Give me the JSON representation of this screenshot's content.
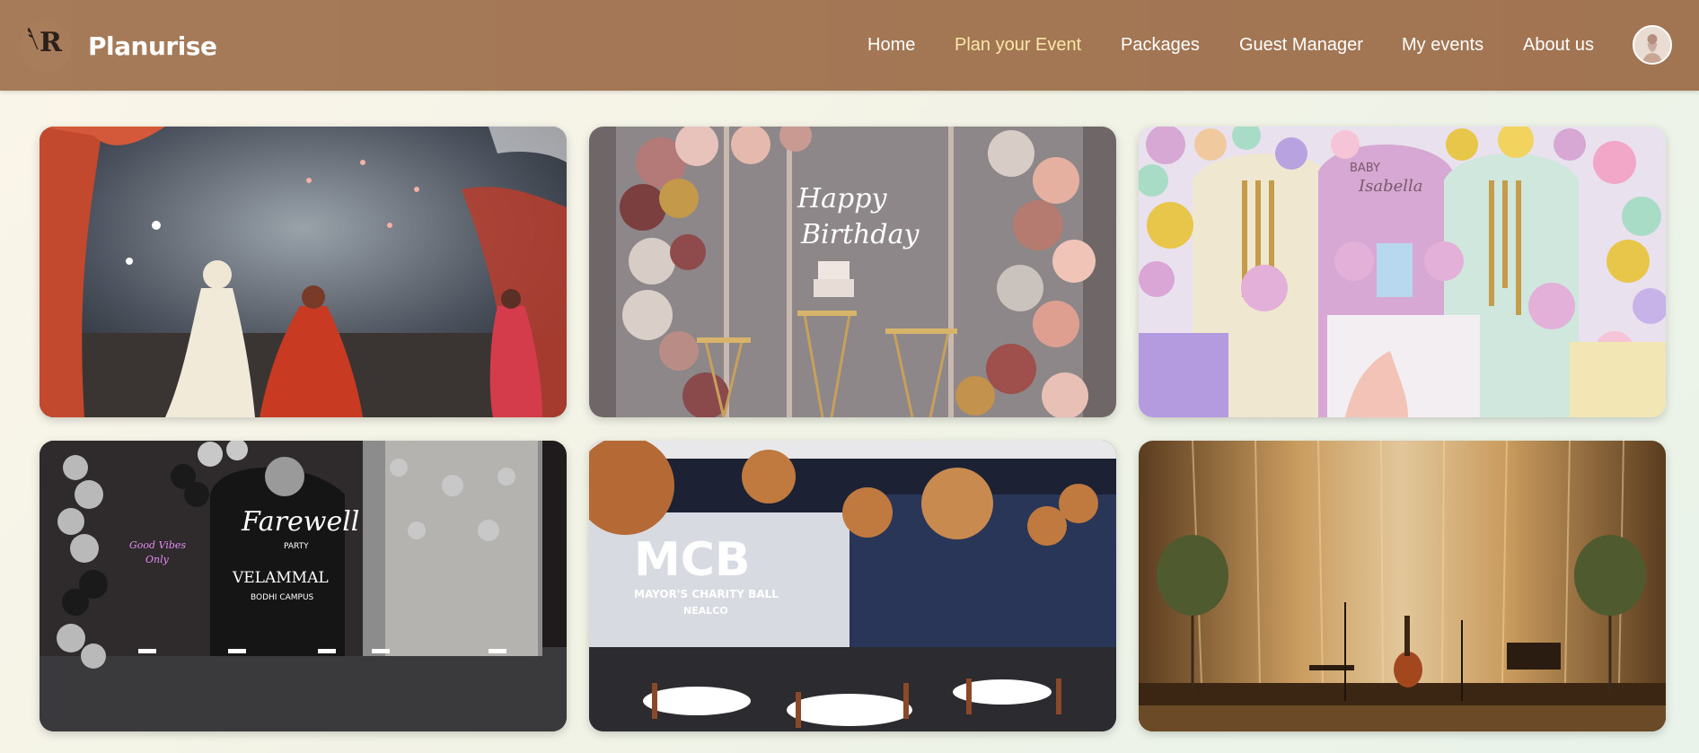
{
  "brand": {
    "name": "Planurise",
    "logo_letter": "R"
  },
  "nav": {
    "items": [
      {
        "label": "Home",
        "active": false
      },
      {
        "label": "Plan your Event",
        "active": true
      },
      {
        "label": "Packages",
        "active": false
      },
      {
        "label": "Guest Manager",
        "active": false
      },
      {
        "label": "My events",
        "active": false
      },
      {
        "label": "About us",
        "active": false
      }
    ],
    "active_color": "#fbe7a8"
  },
  "colors": {
    "navbar": "#a57b59",
    "page_background": "#f4f3e8"
  },
  "gallery": [
    {
      "name": "wedding-photo",
      "texts": []
    },
    {
      "name": "birthday-photo",
      "texts": [
        "Happy",
        "Birthday"
      ]
    },
    {
      "name": "baby-shower-photo",
      "texts": [
        "BABY",
        "Isabella"
      ]
    },
    {
      "name": "farewell-photo",
      "texts": [
        "Farewell",
        "PARTY",
        "VELAMMAL",
        "BODHI CAMPUS",
        "Good Vibes Only"
      ]
    },
    {
      "name": "charity-ball-photo",
      "texts": [
        "MCB",
        "MAYOR'S CHARITY BALL",
        "NEALCO"
      ]
    },
    {
      "name": "stage-lights-photo",
      "texts": []
    }
  ]
}
